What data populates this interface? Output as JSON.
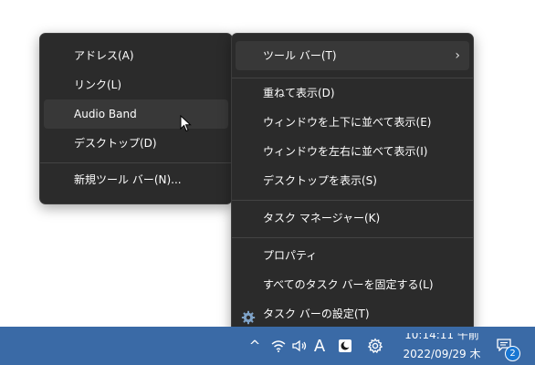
{
  "toolbar_submenu": {
    "items": [
      {
        "label": "アドレス(A)"
      },
      {
        "label": "リンク(L)"
      },
      {
        "label": "Audio Band"
      },
      {
        "label": "デスクトップ(D)"
      },
      {
        "label": "新規ツール バー(N)..."
      }
    ],
    "highlighted": "Audio Band"
  },
  "context_menu": {
    "toolbars": {
      "label": "ツール バー(T)",
      "arrow": "›"
    },
    "cascade": {
      "label": "重ねて表示(D)"
    },
    "stack": {
      "label": "ウィンドウを上下に並べて表示(E)"
    },
    "side_by_side": {
      "label": "ウィンドウを左右に並べて表示(I)"
    },
    "show_desktop": {
      "label": "デスクトップを表示(S)"
    },
    "task_manager": {
      "label": "タスク マネージャー(K)"
    },
    "properties": {
      "label": "プロパティ"
    },
    "lock_taskbar": {
      "label": "すべてのタスク バーを固定する(L)"
    },
    "taskbar_settings": {
      "label": "タスク バーの設定(T)",
      "icon": "gear-icon"
    }
  },
  "taskbar": {
    "tray_chevron": "^",
    "ime_indicator": "A",
    "clock": {
      "time": "10:14:11 午前",
      "date": "2022/09/29 木"
    },
    "notification_count": "2"
  },
  "colors": {
    "menu_bg": "#2b2b2b",
    "menu_highlight": "#383838",
    "taskbar_bg": "#3a6aa6",
    "badge": "#1976d2"
  }
}
